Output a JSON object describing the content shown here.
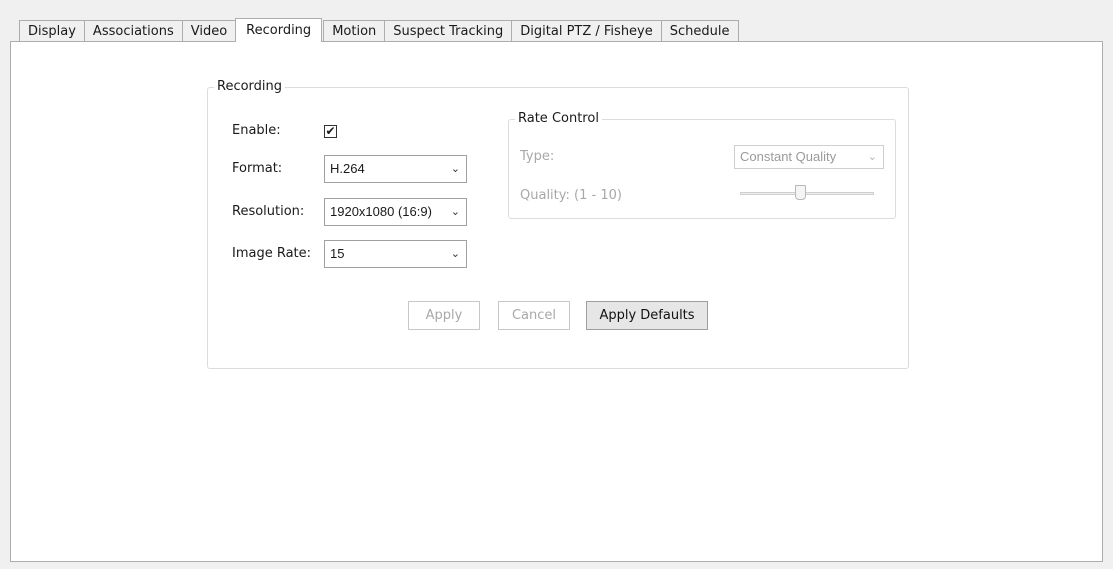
{
  "tabs": [
    {
      "label": "Display",
      "active": false
    },
    {
      "label": "Associations",
      "active": false
    },
    {
      "label": "Video",
      "active": false
    },
    {
      "label": "Recording",
      "active": true
    },
    {
      "label": "Motion",
      "active": false
    },
    {
      "label": "Suspect Tracking",
      "active": false
    },
    {
      "label": "Digital PTZ / Fisheye",
      "active": false
    },
    {
      "label": "Schedule",
      "active": false
    }
  ],
  "recording": {
    "group_title": "Recording",
    "enable_label": "Enable:",
    "enable_checked": true,
    "check_glyph": "✔",
    "format_label": "Format:",
    "format_value": "H.264",
    "resolution_label": "Resolution:",
    "resolution_value": "1920x1080 (16:9)",
    "image_rate_label": "Image Rate:",
    "image_rate_value": "15",
    "dropdown_icon": "chevron-down-icon",
    "chevron_glyph": "⌄"
  },
  "rate_control": {
    "group_title": "Rate Control",
    "type_label": "Type:",
    "type_value": "Constant Quality",
    "quality_label": "Quality: (1 - 10)",
    "quality_value_fraction": 0.45
  },
  "buttons": {
    "apply": "Apply",
    "cancel": "Cancel",
    "apply_defaults": "Apply Defaults"
  },
  "colors": {
    "disabled_text": "#a8a8a8",
    "panel_background": "#ffffff",
    "window_background": "#f0f0f0"
  }
}
